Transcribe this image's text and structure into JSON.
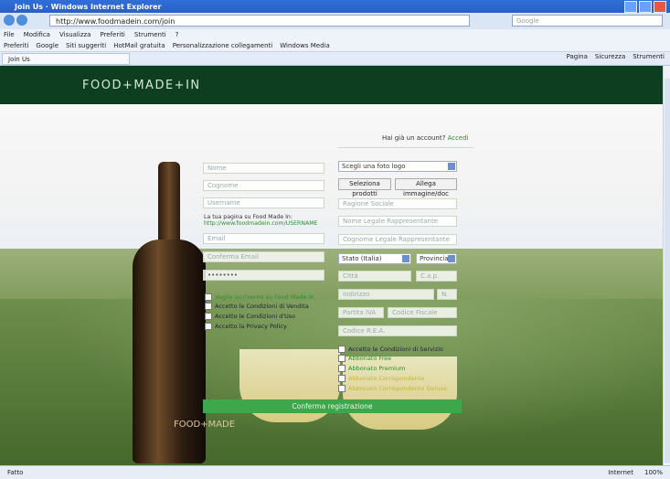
{
  "window": {
    "title": "Join Us · Windows Internet Explorer"
  },
  "address": {
    "url": "http://www.foodmadein.com/join",
    "search_placeholder": "Google"
  },
  "menu": [
    "File",
    "Modifica",
    "Visualizza",
    "Preferiti",
    "Strumenti",
    "?"
  ],
  "favorites": [
    "Preferiti",
    "Google",
    "Siti suggeriti",
    "HotMail gratuita",
    "Personalizzazione collegamenti",
    "Windows Media"
  ],
  "tab": {
    "label": "Join Us"
  },
  "tools": [
    "Pagina",
    "Sicurezza",
    "Strumenti"
  ],
  "site": {
    "logo": "FOOD+MADE+IN",
    "login_prompt": "Hai già un account?",
    "login_link": "Accedi"
  },
  "form": {
    "left_fields": [
      "Nome",
      "Cognome",
      "Username",
      "Email",
      "Conferma Email",
      "••••••••",
      "••••••••"
    ],
    "page_note": "La tua pagina su Food Made In:",
    "page_url": "http://www.foodmadein.com/USERNAME",
    "right": {
      "photo_select": "Scegli una foto logo",
      "products_button": "Seleziona prodotti",
      "attach_button": "Allega immagine/doc",
      "company": "Ragione Sociale",
      "legal_name": "Nome Legale Rappresentante",
      "legal_surname": "Cognome Legale Rappresentante",
      "country": "Stato (Italia)",
      "province": "Provincia",
      "city": "Città",
      "cap": "C.a.p.",
      "address": "Indirizzo",
      "number": "N.",
      "vat": "Partita IVA",
      "tax_code": "Codice Fiscale",
      "rea": "Codice R.E.A."
    },
    "left_checks": [
      {
        "text": "Voglio iscrivermi su Food Made In",
        "style": "g"
      },
      {
        "text": "Accetto le Condizioni di Vendita",
        "style": ""
      },
      {
        "text": "Accetto le Condizioni d'Uso",
        "style": ""
      },
      {
        "text": "Accetto la Privacy Policy",
        "style": ""
      }
    ],
    "right_checks": [
      {
        "text": "Accetto le Condizioni di Servizio",
        "style": ""
      },
      {
        "text": "Abbonato Free",
        "style": "g"
      },
      {
        "text": "Abbonato Premium",
        "style": "g"
      },
      {
        "text": "Abbonato Corrispondente",
        "style": "y"
      },
      {
        "text": "Abbonato Corrispondente Deluxe",
        "style": "y"
      }
    ],
    "submit": "Conferma registrazione"
  },
  "status": {
    "text": "Fatto",
    "zone": "Internet",
    "zoom": "100%"
  }
}
